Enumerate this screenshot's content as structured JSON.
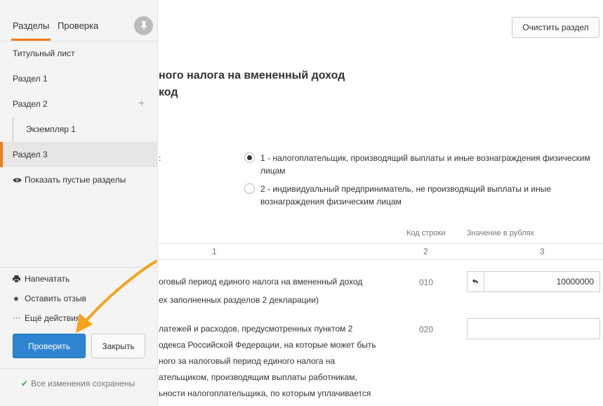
{
  "main": {
    "clear_button": "Очистить раздел",
    "title_line1": "ного налога на вмененный доход",
    "title_line2": "код",
    "payer_label": ":",
    "options": [
      {
        "line1": "1 - налогоплательщик, производящий выплаты и иные вознаграждения физическим",
        "line2": "лицам",
        "checked": true
      },
      {
        "line1": "2 - индивидуальный предприниматель, не производящий выплаты и иные",
        "line2": "вознаграждения физическим лицам",
        "checked": false
      }
    ],
    "columns": {
      "code_header": "Код строки",
      "value_header": "Значение в рублях",
      "num1": "1",
      "num2": "2",
      "num3": "3"
    },
    "rows": [
      {
        "line1": "оговый период единого налога на вмененный доход",
        "line2": "ех заполненных разделов 2 декларации)",
        "code": "010",
        "value": "10000000"
      },
      {
        "line1": "латежей и расходов, предусмотренных пунктом 2",
        "line2": "одекса Российской Федерации, на которые может быть",
        "line3": "ного за налоговый период единого налога на",
        "line4": "ательщиком, производящим выплаты работникам,",
        "line5": "ьности налогоплательщика, по которым уплачивается",
        "code": "020",
        "value": ""
      }
    ]
  },
  "sidebar": {
    "tabs": [
      "Разделы",
      "Проверка"
    ],
    "items": [
      {
        "label": "Титульный лист"
      },
      {
        "label": "Раздел 1"
      },
      {
        "label": "Раздел 2"
      },
      {
        "label": "Экземпляр 1"
      },
      {
        "label": "Раздел 3"
      }
    ],
    "show_empty": "Показать пустые разделы",
    "actions": {
      "print": "Напечатать",
      "feedback": "Оставить отзыв",
      "more": "Ещё действия"
    },
    "check_button": "Проверить",
    "close_button": "Закрыть",
    "saved_status": "Все изменения сохранены"
  },
  "colors": {
    "accent": "#f07d1a",
    "primary_button": "#2f85d1",
    "saved_check": "#4aa44a"
  },
  "icons": [
    "pin-icon",
    "plus-icon",
    "eye-icon",
    "printer-icon",
    "star-icon",
    "more-icon",
    "reset-icon",
    "check-icon",
    "arrow-annotation"
  ]
}
